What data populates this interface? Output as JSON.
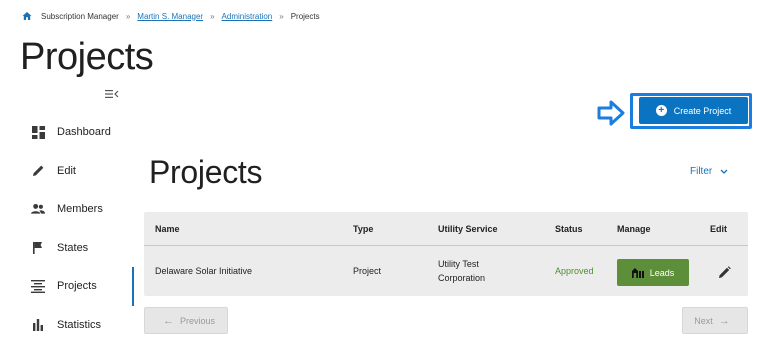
{
  "breadcrumb": {
    "items": [
      {
        "label": "Subscription Manager"
      },
      {
        "label": "Martin S. Manager"
      },
      {
        "label": "Administration"
      },
      {
        "label": "Projects"
      }
    ],
    "separator": "»"
  },
  "page": {
    "title": "Projects"
  },
  "sidebar": {
    "items": [
      {
        "label": "Dashboard",
        "icon": "dashboard-icon"
      },
      {
        "label": "Edit",
        "icon": "pencil-icon"
      },
      {
        "label": "Members",
        "icon": "members-icon"
      },
      {
        "label": "States",
        "icon": "flag-icon"
      },
      {
        "label": "Projects",
        "icon": "projects-icon",
        "active": true
      },
      {
        "label": "Statistics",
        "icon": "bar-chart-icon"
      }
    ]
  },
  "actions": {
    "create_project": "Create Project"
  },
  "section": {
    "title": "Projects",
    "filter_label": "Filter"
  },
  "table": {
    "headers": [
      "Name",
      "Type",
      "Utility Service",
      "Status",
      "Manage",
      "Edit"
    ],
    "rows": [
      {
        "name": "Delaware Solar Initiative",
        "type": "Project",
        "utility_line1": "Utility Test",
        "utility_line2": "Corporation",
        "status": "Approved",
        "manage_label": "Leads"
      }
    ]
  },
  "pager": {
    "previous": "Previous",
    "next": "Next"
  },
  "colors": {
    "primary": "#0b74c2",
    "success": "#5d8f3a",
    "status_approved": "#4f8f2f",
    "focus": "#1b7de0"
  }
}
